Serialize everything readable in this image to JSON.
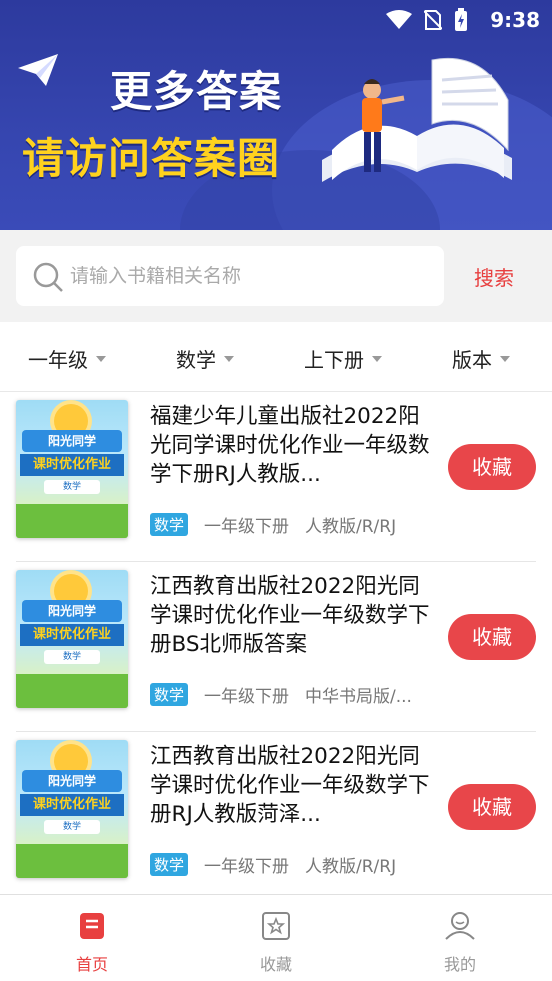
{
  "status": {
    "time": "9:38"
  },
  "banner": {
    "line1": "更多答案",
    "line2": "请访问答案圈"
  },
  "search": {
    "placeholder": "请输入书籍相关名称",
    "button": "搜索"
  },
  "filters": [
    "一年级",
    "数学",
    "上下册",
    "版本"
  ],
  "books": [
    {
      "title": "福建少年儿童出版社2022阳光同学课时优化作业一年级数学下册RJ人教版...",
      "subject": "数学",
      "grade": "一年级下册",
      "edition": "人教版/R/RJ",
      "action": "收藏",
      "cover": {
        "band1": "阳光同学",
        "band2": "课时优化作业",
        "subject": "数学"
      }
    },
    {
      "title": "江西教育出版社2022阳光同学课时优化作业一年级数学下册BS北师版答案",
      "subject": "数学",
      "grade": "一年级下册",
      "edition": "中华书局版/...",
      "action": "收藏",
      "cover": {
        "band1": "阳光同学",
        "band2": "课时优化作业",
        "subject": "数学"
      }
    },
    {
      "title": "江西教育出版社2022阳光同学课时优化作业一年级数学下册RJ人教版菏泽...",
      "subject": "数学",
      "grade": "一年级下册",
      "edition": "人教版/R/RJ",
      "action": "收藏",
      "cover": {
        "band1": "阳光同学",
        "band2": "课时优化作业",
        "subject": "数学"
      }
    }
  ],
  "nav": {
    "home": "首页",
    "favorites": "收藏",
    "mine": "我的"
  },
  "colors": {
    "accent": "#e84040",
    "banner": "#3646b0",
    "tag": "#2fa6e0"
  }
}
